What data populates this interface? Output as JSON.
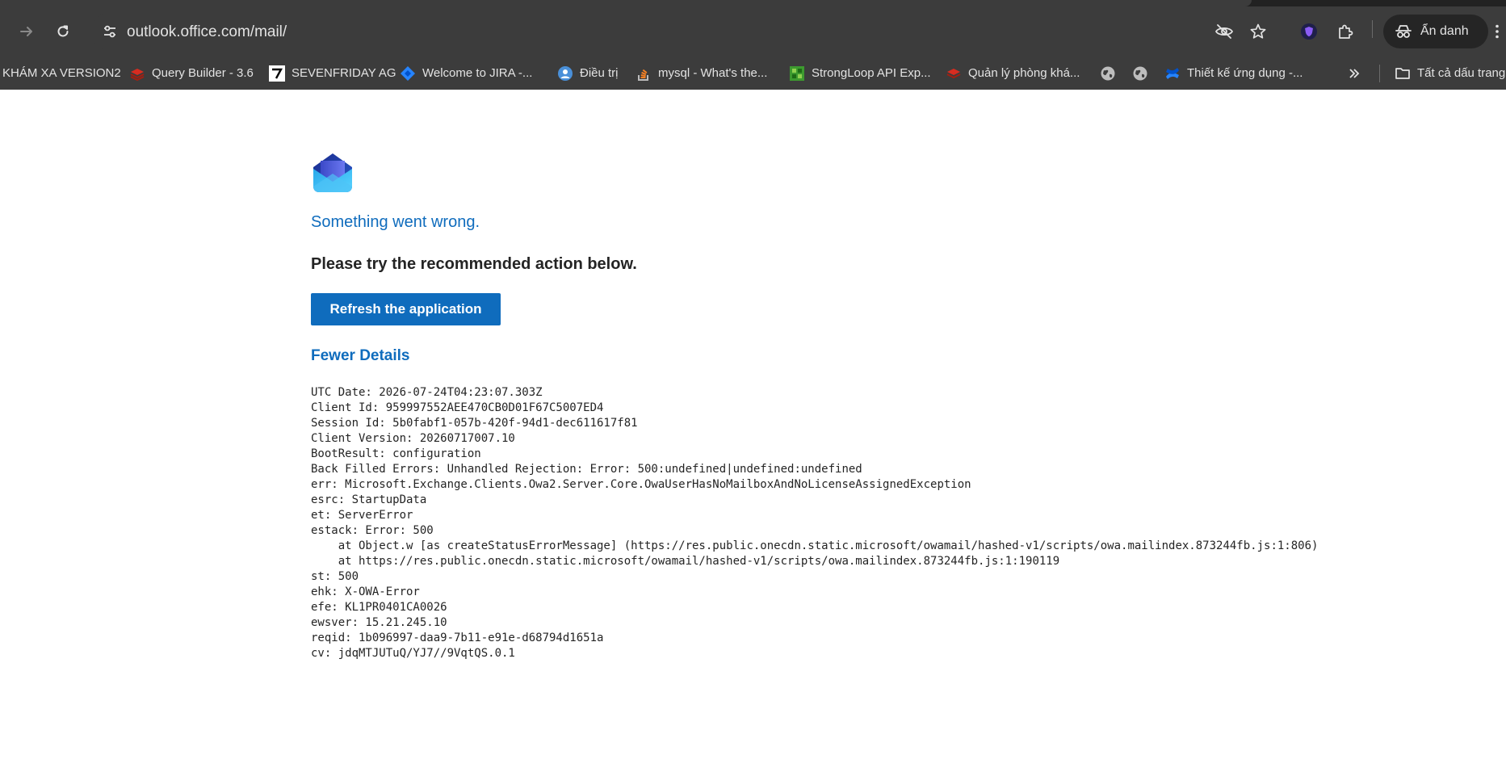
{
  "browser": {
    "url": "outlook.office.com/mail/",
    "incognito_label": "Ẩn danh",
    "bookmarks": [
      {
        "label": "KHÁM XA VERSION2",
        "icon": "none"
      },
      {
        "label": "Query Builder - 3.6",
        "icon": "redis-icon"
      },
      {
        "label": "SEVENFRIDAY AG",
        "icon": "sevenfriday-icon"
      },
      {
        "label": "Welcome to JIRA -...",
        "icon": "jira-icon"
      },
      {
        "label": "Điều trị",
        "icon": "globe-person-icon"
      },
      {
        "label": "mysql - What's the...",
        "icon": "stackoverflow-icon"
      },
      {
        "label": "StrongLoop API Exp...",
        "icon": "strongloop-icon"
      },
      {
        "label": "Quản lý phòng khá...",
        "icon": "redis-icon"
      },
      {
        "label": "",
        "icon": "globe-icon"
      },
      {
        "label": "",
        "icon": "globe-icon"
      },
      {
        "label": "Thiết kế ứng dụng -...",
        "icon": "confluence-icon"
      },
      {
        "label": "Tất cả dấu trang",
        "icon": "folder-icon"
      }
    ]
  },
  "page": {
    "title": "Something went wrong.",
    "subtitle": "Please try the recommended action below.",
    "refresh_button": "Refresh the application",
    "details_toggle": "Fewer Details",
    "details_text": "UTC Date: 2026-07-24T04:23:07.303Z\nClient Id: 959997552AEE470CB0D01F67C5007ED4\nSession Id: 5b0fabf1-057b-420f-94d1-dec611617f81\nClient Version: 20260717007.10\nBootResult: configuration\nBack Filled Errors: Unhandled Rejection: Error: 500:undefined|undefined:undefined\nerr: Microsoft.Exchange.Clients.Owa2.Server.Core.OwaUserHasNoMailboxAndNoLicenseAssignedException\nesrc: StartupData\net: ServerError\nestack: Error: 500\n    at Object.w [as createStatusErrorMessage] (https://res.public.onecdn.static.microsoft/owamail/hashed-v1/scripts/owa.mailindex.873244fb.js:1:806)\n    at https://res.public.onecdn.static.microsoft/owamail/hashed-v1/scripts/owa.mailindex.873244fb.js:1:190119\nst: 500\nehk: X-OWA-Error\nefe: KL1PR0401CA0026\newsver: 15.21.245.10\nreqid: 1b096997-daa9-7b11-e91e-d68794d1651a\ncv: jdqMTJUTuQ/YJ7//9VqtQS.0.1"
  },
  "colors": {
    "accent": "#0f6cbd",
    "chrome_bg": "#3c3c3c",
    "text_dark": "#242424"
  }
}
